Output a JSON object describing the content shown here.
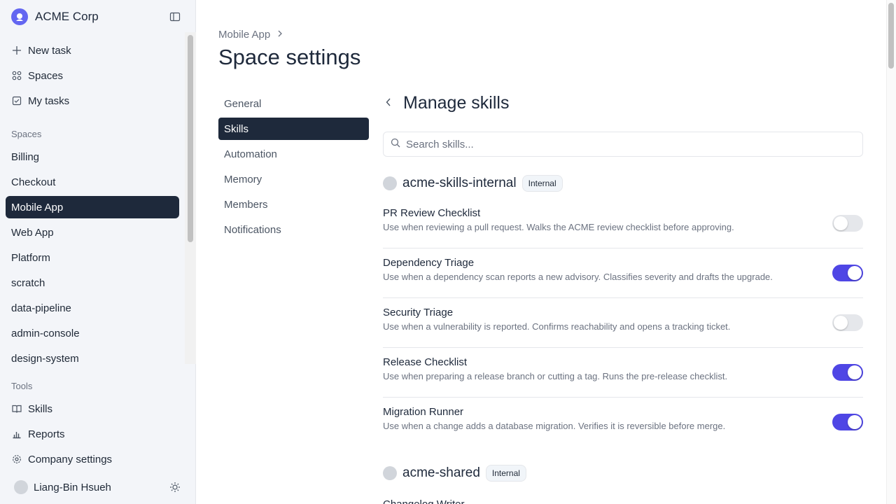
{
  "sidebar": {
    "brand_name": "ACME Corp",
    "top_items": [
      {
        "label": "New task",
        "icon": "plus-icon"
      },
      {
        "label": "Spaces",
        "icon": "grid-icon"
      },
      {
        "label": "My tasks",
        "icon": "checkbox-icon"
      }
    ],
    "spaces_label": "Spaces",
    "spaces": [
      "Billing",
      "Checkout",
      "Mobile App",
      "Web App",
      "Platform",
      "scratch",
      "data-pipeline",
      "admin-console",
      "design-system"
    ],
    "active_space": "Mobile App",
    "tools_label": "Tools",
    "tools": [
      {
        "label": "Skills",
        "icon": "book-icon"
      },
      {
        "label": "Reports",
        "icon": "bar-chart-icon"
      },
      {
        "label": "Company settings",
        "icon": "gear-icon"
      }
    ],
    "user_name": "Liang-Bin Hsueh"
  },
  "header": {
    "breadcrumb": "Mobile App",
    "title": "Space settings"
  },
  "subnav": {
    "items": [
      "General",
      "Skills",
      "Automation",
      "Memory",
      "Members",
      "Notifications"
    ],
    "active": "Skills"
  },
  "panel": {
    "title": "Manage skills",
    "search_placeholder": "Search skills...",
    "groups": [
      {
        "name": "acme-skills-internal",
        "badge": "Internal",
        "skills": [
          {
            "name": "PR Review Checklist",
            "description": "Use when reviewing a pull request. Walks the ACME review checklist before approving.",
            "enabled": false
          },
          {
            "name": "Dependency Triage",
            "description": "Use when a dependency scan reports a new advisory. Classifies severity and drafts the upgrade.",
            "enabled": true
          },
          {
            "name": "Security Triage",
            "description": "Use when a vulnerability is reported. Confirms reachability and opens a tracking ticket.",
            "enabled": false
          },
          {
            "name": "Release Checklist",
            "description": "Use when preparing a release branch or cutting a tag. Runs the pre-release checklist.",
            "enabled": true
          },
          {
            "name": "Migration Runner",
            "description": "Use when a change adds a database migration. Verifies it is reversible before merge.",
            "enabled": true
          }
        ]
      },
      {
        "name": "acme-shared",
        "badge": "Internal",
        "partial_skill_name": "Changelog Writer"
      }
    ]
  },
  "colors": {
    "accent": "#4f46e5",
    "active_bg": "#1e293b",
    "sidebar_bg": "#f3f5f9"
  }
}
